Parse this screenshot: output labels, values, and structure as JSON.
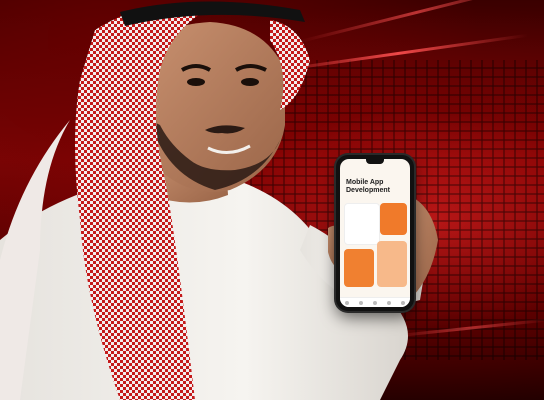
{
  "phone": {
    "title": "Mobile App Development",
    "tabs": [
      "home-icon",
      "search-icon",
      "apps-icon",
      "profile-icon",
      "menu-icon"
    ]
  },
  "colors": {
    "background_red": "#b30000",
    "accent_orange": "#f07a2a",
    "ghutra_red": "#c81a1a",
    "thobe_white": "#f4f2ee"
  }
}
